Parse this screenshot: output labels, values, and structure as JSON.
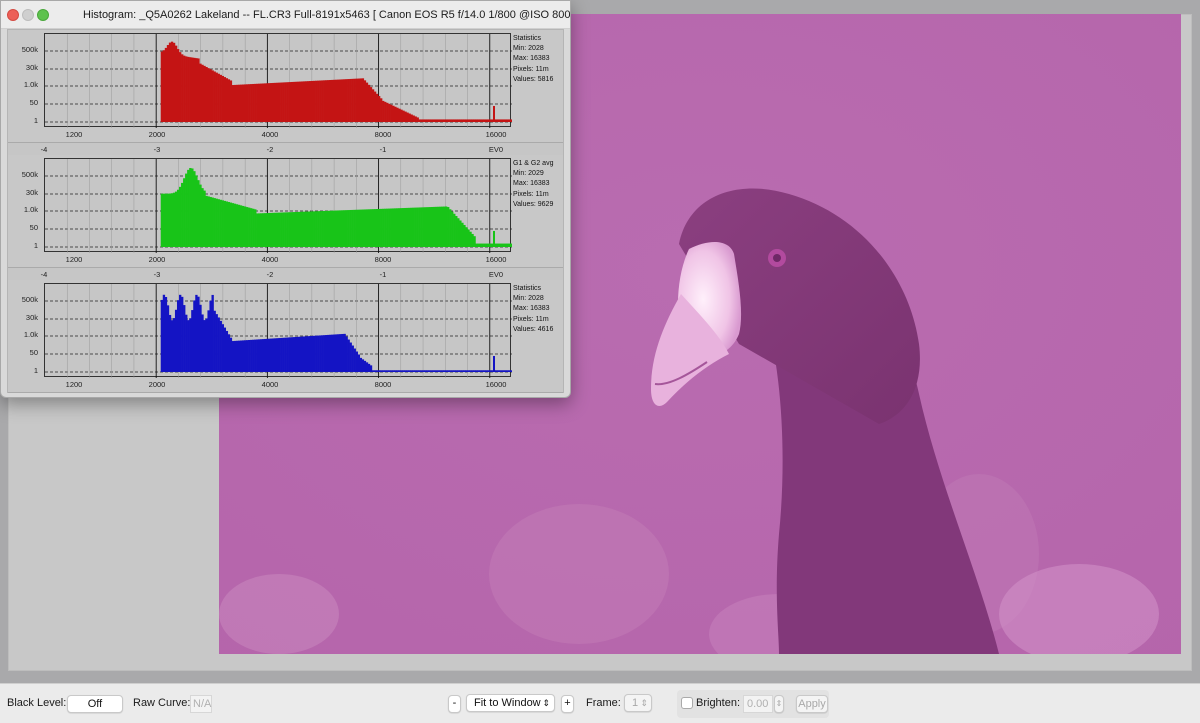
{
  "window": {
    "title": "Histogram: _Q5A0262  Lakeland -- FL.CR3 Full-8191x5463 [ Canon EOS R5 f/14.0 1/800 @ISO 800 ]"
  },
  "histogram": {
    "y_ticks": [
      "500k",
      "30k",
      "1.0k",
      "50",
      "1"
    ],
    "x_ticks": [
      "1200",
      "2000",
      "4000",
      "8000",
      "16000"
    ],
    "ev_ticks": [
      "-4",
      "-3",
      "-2",
      "-1",
      "EV0"
    ],
    "panels": [
      {
        "channel": "red",
        "color": "#c41414",
        "stats": {
          "heading": "Statistics",
          "min": "Min: 2028",
          "max": "Max: 16383",
          "pixels": "Pixels: 11m",
          "values": "Values: 5816"
        }
      },
      {
        "channel": "green",
        "color": "#18c418",
        "stats": {
          "heading": "G1 & G2 avg",
          "min": "Min: 2029",
          "max": "Max: 16383",
          "pixels": "Pixels: 11m",
          "values": "Values: 9629"
        }
      },
      {
        "channel": "blue",
        "color": "#1414c4",
        "stats": {
          "heading": "Statistics",
          "min": "Min: 2028",
          "max": "Max: 16383",
          "pixels": "Pixels: 11m",
          "values": "Values: 4616"
        }
      }
    ]
  },
  "toolbar": {
    "black_level_label": "Black Level:",
    "black_level_value": "Off",
    "raw_curve_label": "Raw Curve:",
    "raw_curve_value": "N/A",
    "zoom_minus": "-",
    "zoom_mode": "Fit to Window",
    "zoom_plus": "+",
    "frame_label": "Frame:",
    "frame_value": "1",
    "brighten_label": "Brighten:",
    "brighten_value": "0.00",
    "apply_label": "Apply"
  },
  "colors": {
    "photo_tint": "#b86aae"
  }
}
